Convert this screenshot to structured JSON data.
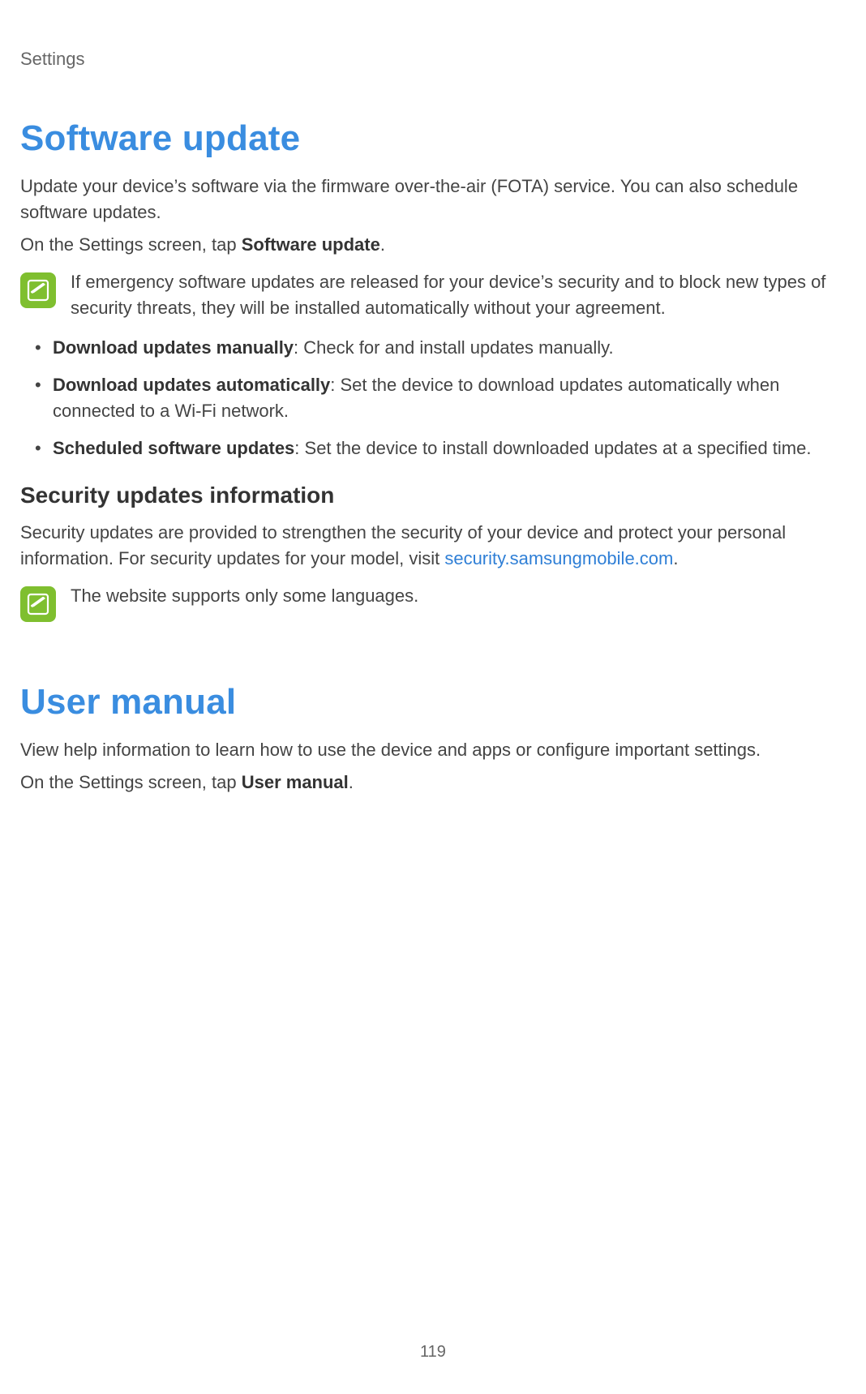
{
  "header": {
    "breadcrumb": "Settings"
  },
  "software_update": {
    "title": "Software update",
    "intro": "Update your device’s software via the firmware over-the-air (FOTA) service. You can also schedule software updates.",
    "nav_prefix": "On the Settings screen, tap ",
    "nav_bold": "Software update",
    "nav_suffix": ".",
    "note1": "If emergency software updates are released for your device’s security and to block new types of security threats, they will be installed automatically without your agreement.",
    "bullets": [
      {
        "label": "Download updates manually",
        "desc": ": Check for and install updates manually."
      },
      {
        "label": "Download updates automatically",
        "desc": ": Set the device to download updates automatically when connected to a Wi-Fi network."
      },
      {
        "label": "Scheduled software updates",
        "desc": ": Set the device to install downloaded updates at a specified time."
      }
    ],
    "sub_heading": "Security updates information",
    "sub_text_prefix": "Security updates are provided to strengthen the security of your device and protect your personal information. For security updates for your model, visit ",
    "sub_link_text": "security.samsungmobile.com",
    "sub_text_suffix": ".",
    "note2": "The website supports only some languages."
  },
  "user_manual": {
    "title": "User manual",
    "intro": "View help information to learn how to use the device and apps or configure important settings.",
    "nav_prefix": "On the Settings screen, tap ",
    "nav_bold": "User manual",
    "nav_suffix": "."
  },
  "page_number": "119"
}
